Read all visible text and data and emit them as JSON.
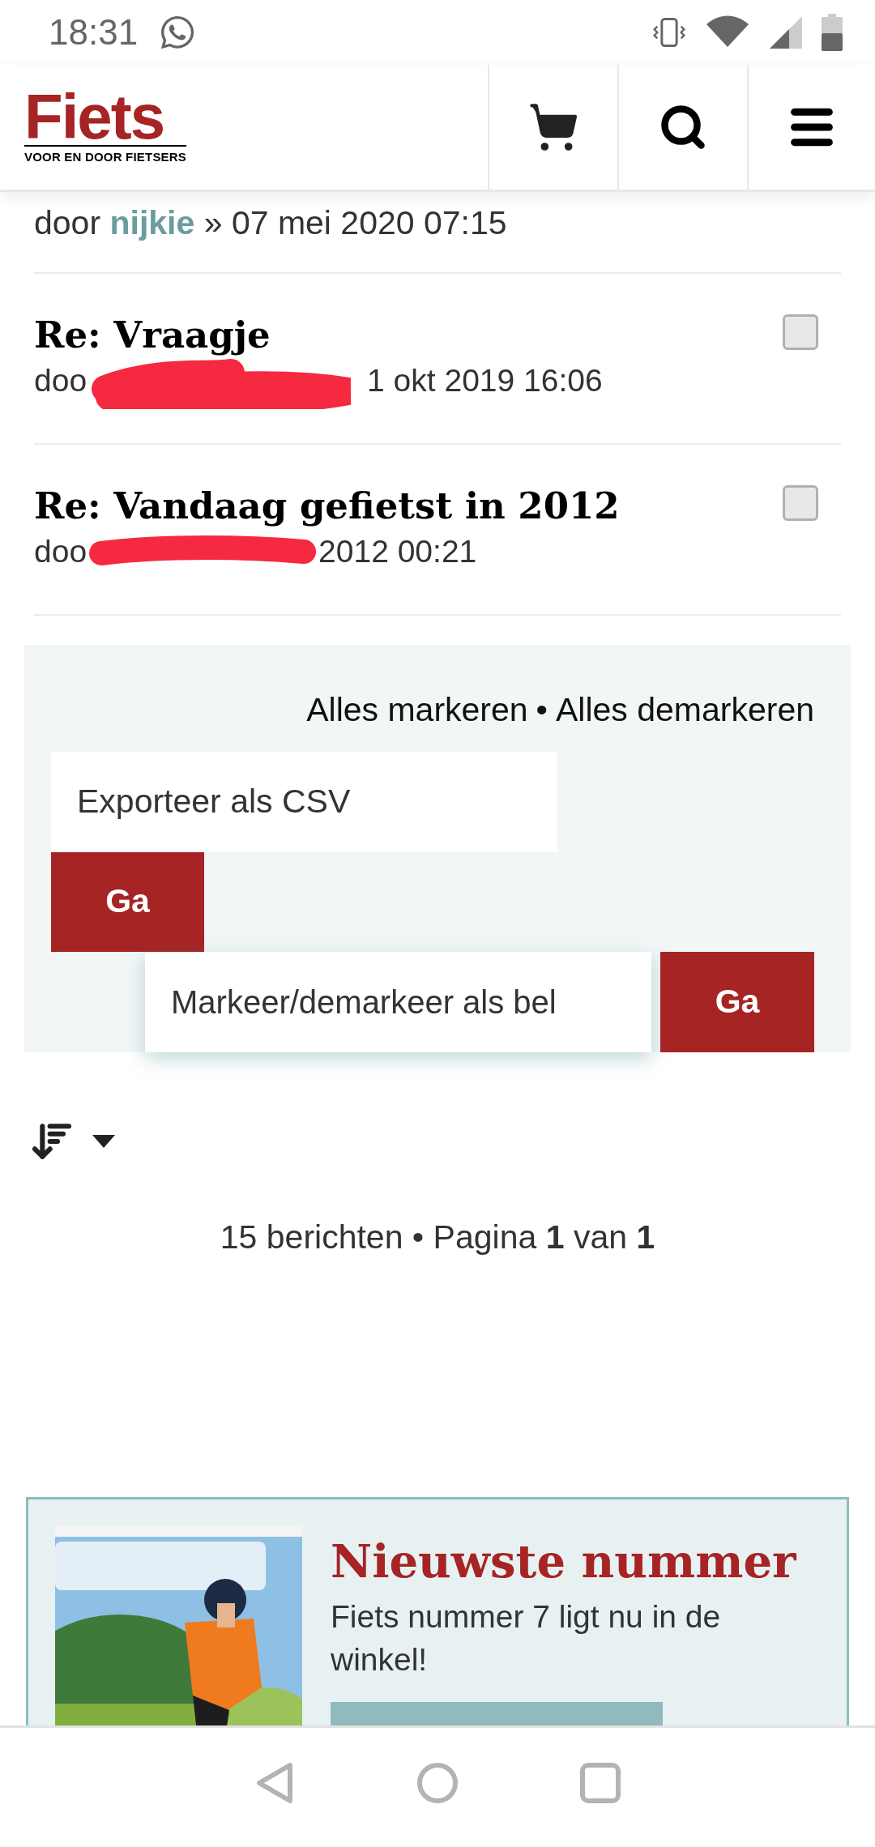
{
  "status_bar": {
    "time": "18:31"
  },
  "header": {
    "logo": {
      "name": "Fiets",
      "tagline": "VOOR EN DOOR FIETSERS"
    }
  },
  "posts": [
    {
      "kind": "meta_only",
      "prefix": "door",
      "author": "nijkie",
      "date": "» 07 mei 2020 07:15"
    },
    {
      "kind": "post",
      "title": "Re: Vraagje",
      "checked": false,
      "redacted": true,
      "meta_start": "doo",
      "meta_end": "1 okt 2019 16:06"
    },
    {
      "kind": "post",
      "title": "Re: Vandaag gefietst in 2012",
      "checked": false,
      "redacted": true,
      "meta_start": "doo",
      "meta_end": "2012 00:21"
    }
  ],
  "actions": {
    "mark_all": "Alles markeren",
    "separator": "•",
    "unmark_all": "Alles demarkeren",
    "export_select": "Exporteer als CSV",
    "export_button": "Ga",
    "mark_select": "Markeer/demarkeer als bel",
    "mark_button": "Ga"
  },
  "pagination": "15 berichten • Pagina **1** van **1**",
  "promo": {
    "title": "Nieuwste nummer",
    "text": "Fiets nummer 7 ligt nu in de winkel!"
  }
}
